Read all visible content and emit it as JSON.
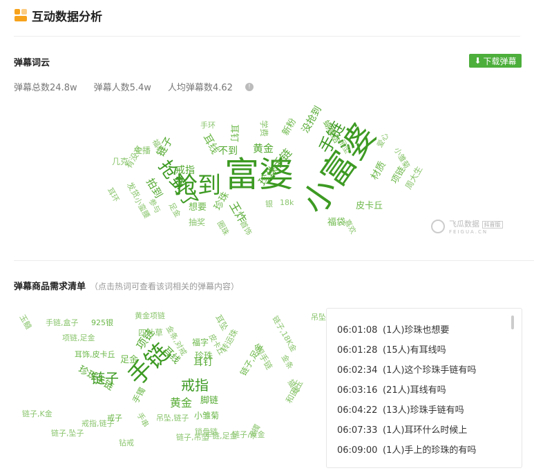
{
  "header": {
    "title": "互动数据分析"
  },
  "danmu_cloud": {
    "title": "弹幕词云",
    "download_label": "下载弹幕",
    "stats": [
      {
        "label": "弹幕总数",
        "value": "24.8w"
      },
      {
        "label": "弹幕人数",
        "value": "5.4w"
      },
      {
        "label": "人均弹幕数",
        "value": "4.62"
      }
    ],
    "words": [
      "富婆",
      "小富婆",
      "抢到",
      "抢到了",
      "手链",
      "珍珠手链",
      "王炸",
      "黄金",
      "耳线",
      "不到",
      "耳钉",
      "戒指",
      "链子",
      "拍到",
      "没抢到",
      "新粉",
      "爱心",
      "材质",
      "项链",
      "皮卡丘",
      "福袋",
      "想要",
      "抽奖",
      "珍珠",
      "圈珠",
      "周大生",
      "小雏菊",
      "首饰",
      "主播",
      "福利",
      "几克",
      "有没有",
      "耳环",
      "发货",
      "参与",
      "小蛮腰",
      "足金",
      "18k",
      "喜欢",
      "学费",
      "银",
      "手环",
      "蝴蝶结",
      "吊坠"
    ],
    "watermark": {
      "brand": "飞瓜数据",
      "sub": "FEIGUA.CN",
      "badge": "抖音版"
    }
  },
  "demand": {
    "title": "弹幕商品需求清单",
    "hint": "（点击热词可查看该词相关的弹幕内容）",
    "words": [
      "手链",
      "链子",
      "戒指",
      "项链",
      "黄金",
      "珍珠手链",
      "耳钉",
      "耳线",
      "脚链",
      "珍珠",
      "足金",
      "手镯",
      "小雏菊",
      "玉髓",
      "银手链",
      "手链,盒子",
      "925银",
      "黄金项链",
      "四叶草",
      "金条,对戒",
      "项链,足金",
      "耳饰,皮卡丘",
      "福字",
      "皮卡丘",
      "转运珠",
      "链子,足金",
      "链子,K金",
      "链子,18K金",
      "链子,坠子",
      "戒指,链子",
      "链子,黄金",
      "吊坠",
      "手链,足金",
      "钻戒",
      "戒子",
      "吊坠,链子",
      "和田玉",
      "猫眼",
      "金条",
      "手串",
      "锁骨链",
      "耳坠",
      "玉镯",
      "链子,吊坠"
    ]
  },
  "comments": [
    {
      "time": "06:01:08",
      "text": "(1人)珍珠也想要"
    },
    {
      "time": "06:01:28",
      "text": "(15人)有耳线吗"
    },
    {
      "time": "06:02:34",
      "text": "(1人)这个珍珠手链有吗"
    },
    {
      "time": "06:03:16",
      "text": "(21人)耳线有吗"
    },
    {
      "time": "06:04:22",
      "text": "(13人)珍珠手链有吗"
    },
    {
      "time": "06:07:33",
      "text": "(1人)耳环什么时候上"
    },
    {
      "time": "06:09:00",
      "text": "(1人)手上的珍珠的有吗"
    }
  ]
}
